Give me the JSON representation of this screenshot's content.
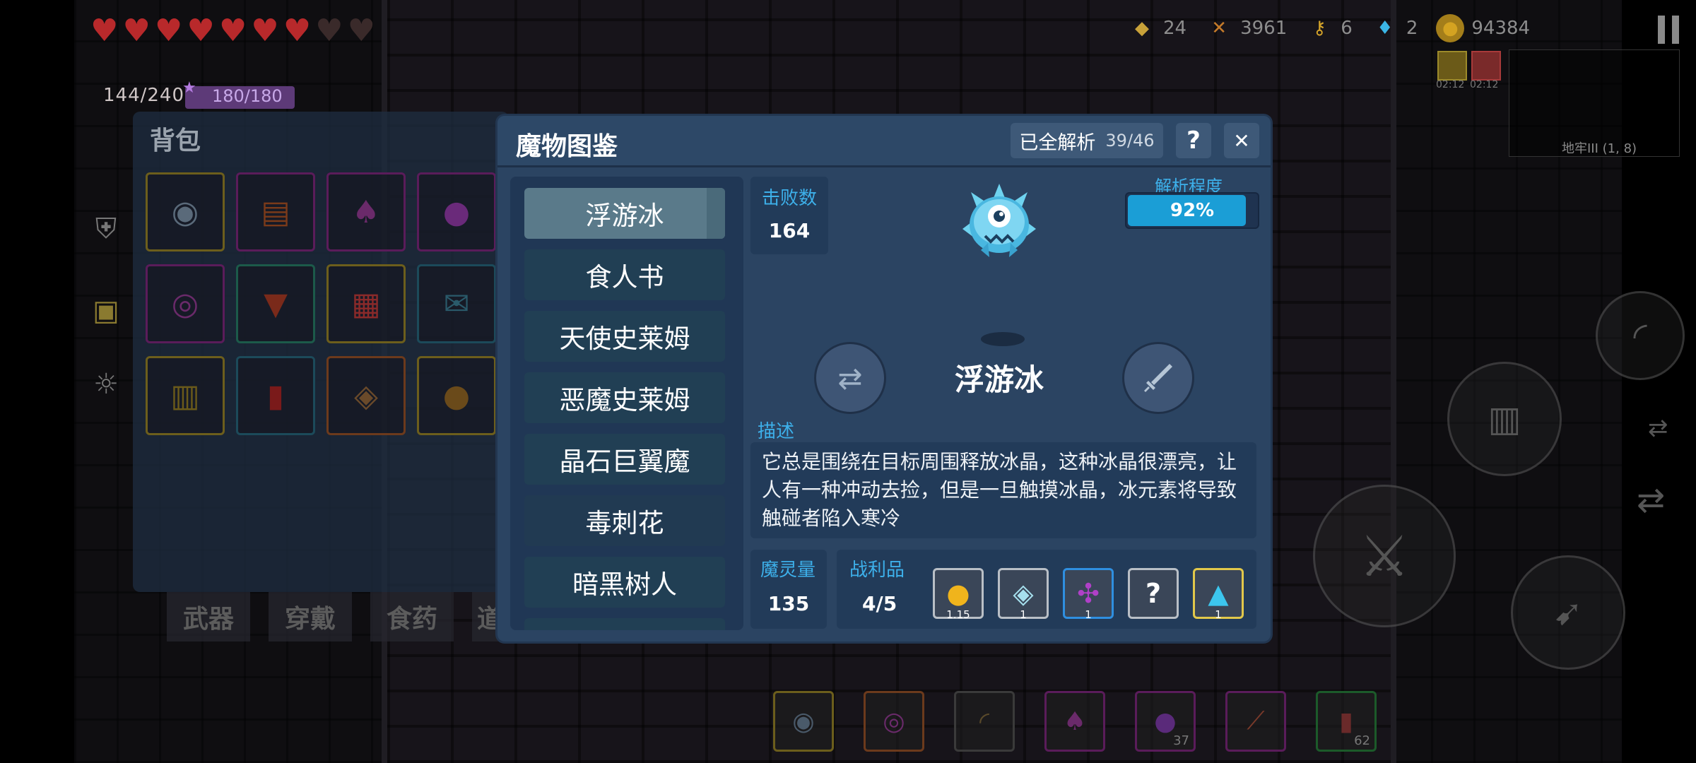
{
  "hud": {
    "hp": "144/240",
    "mp": "180/180",
    "resources": [
      {
        "icon": "gem-crest-icon",
        "value": "24",
        "color": "#c9a23a"
      },
      {
        "icon": "crossbow-icon",
        "value": "3961",
        "color": "#c47a2a"
      },
      {
        "icon": "key-icon",
        "value": "6",
        "color": "#d6a52a"
      },
      {
        "icon": "diamond-icon",
        "value": "2",
        "color": "#3bb6e6"
      },
      {
        "icon": "coin-icon",
        "value": "94384",
        "color": "#d4a321"
      }
    ],
    "buffs": [
      "02:12",
      "02:12"
    ],
    "location": "地牢III (1, 8)"
  },
  "backpack": {
    "title": "背包",
    "tabs": [
      "武器",
      "穿戴",
      "食药",
      "道"
    ]
  },
  "hotbar": {
    "counts": [
      "37",
      "62"
    ]
  },
  "modal": {
    "title": "魔物图鉴",
    "analyzed_label": "已全解析",
    "analyzed_value": "39/46",
    "help": "?",
    "close": "✕",
    "monsters": [
      "浮游冰",
      "食人书",
      "天使史莱姆",
      "恶魔史莱姆",
      "晶石巨翼魔",
      "毒刺花",
      "暗黑树人"
    ],
    "selected_index": 0,
    "detail": {
      "kills_label": "击败数",
      "kills": "164",
      "progress_label": "解析程度",
      "progress_text": "92%",
      "progress_value": 0.92,
      "name": "浮游冰",
      "desc_label": "描述",
      "description": "它总是围绕在目标周围释放冰晶，这种冰晶很漂亮，让人有一种冲动去捡，但是一旦触摸冰晶，冰元素将导致触碰者陷入寒冷",
      "mana_label": "魔灵量",
      "mana": "135",
      "loot_label": "战利品",
      "loot_count": "4/5",
      "loot": [
        {
          "icon": "gold-coin-icon",
          "count": "1.15",
          "border": "#b9bfc6"
        },
        {
          "icon": "crystal-icon",
          "count": "1",
          "border": "#b9bfc6"
        },
        {
          "icon": "purple-orb-icon",
          "count": "1",
          "border": "#2f8fe0"
        },
        {
          "icon": "unknown-icon",
          "label": "?",
          "border": "#b9bfc6"
        },
        {
          "icon": "ice-crystal-icon",
          "count": "1",
          "border": "#e2c84a"
        }
      ]
    }
  }
}
